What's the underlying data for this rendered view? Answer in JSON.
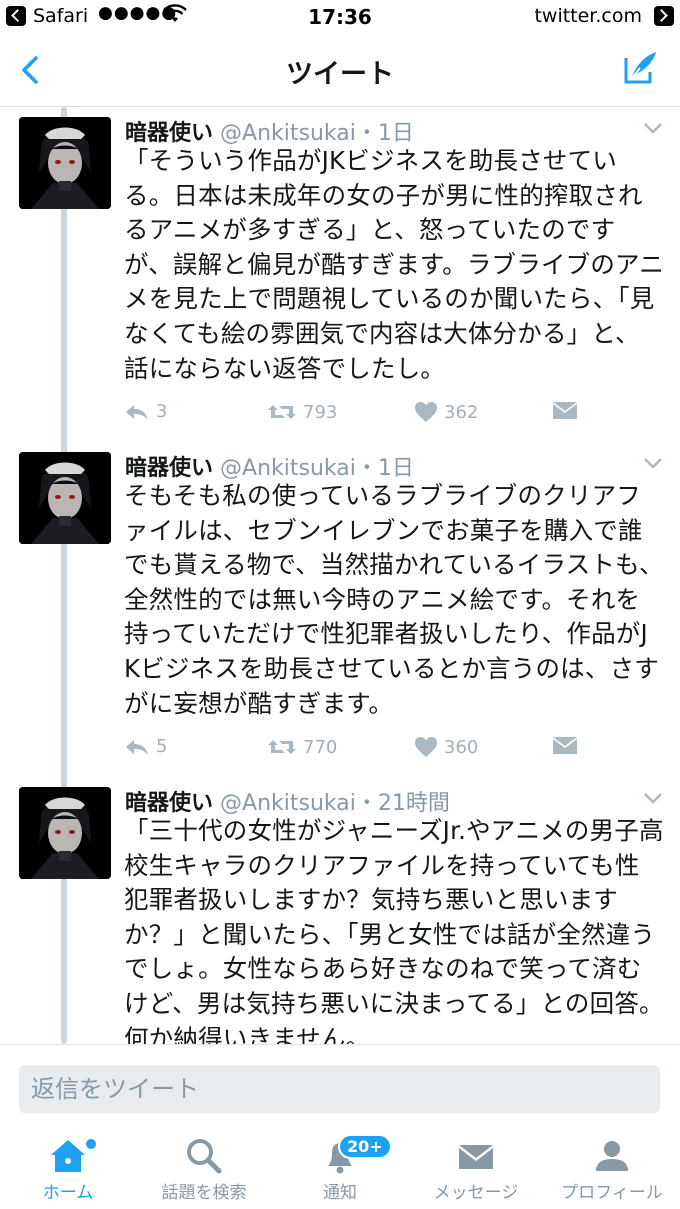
{
  "status_bar": {
    "carrier": "Safari",
    "signal": "●●●●●",
    "time": "17:36",
    "url": "twitter.com"
  },
  "nav": {
    "title": "ツイート",
    "back_icon": "chevron-left-icon",
    "compose_icon": "compose-tweet-icon"
  },
  "tweets": [
    {
      "name": "暗器使い",
      "handle": "@Ankitsukai",
      "time": "1日",
      "text": "「そういう作品がJKビジネスを助長させている。日本は未成年の女の子が男に性的搾取されるアニメが多すぎる」と、怒っていたのですが、誤解と偏見が酷すぎます。ラブライブのアニメを見た上で問題視しているのか聞いたら、「見なくても絵の雰囲気で内容は大体分かる」と、話にならない返答でしたし。",
      "reply_count": "3",
      "retweet_count": "793",
      "like_count": "362"
    },
    {
      "name": "暗器使い",
      "handle": "@Ankitsukai",
      "time": "1日",
      "text": "そもそも私の使っているラブライブのクリアファイルは、セブンイレブンでお菓子を購入で誰でも貰える物で、当然描かれているイラストも、全然性的では無い今時のアニメ絵です。それを持っていただけで性犯罪者扱いしたり、作品がJKビジネスを助長させているとか言うのは、さすがに妄想が酷すぎます。",
      "reply_count": "5",
      "retweet_count": "770",
      "like_count": "360"
    },
    {
      "name": "暗器使い",
      "handle": "@Ankitsukai",
      "time": "21時間",
      "text": "「三十代の女性がジャニーズJr.やアニメの男子高校生キャラのクリアファイルを持っていても性犯罪者扱いしますか？気持ち悪いと思いますか？」と聞いたら、「男と女性では話が全然違うでしょ。女性ならあら好きなのねで笑って済むけど、男は気持ち悪いに決まってる」との回答。何か納得いきません。",
      "reply_count": "",
      "retweet_count": "",
      "like_count": ""
    }
  ],
  "reply_bar": {
    "placeholder": "返信をツイート"
  },
  "tabs": [
    {
      "label": "ホーム",
      "icon": "home-icon"
    },
    {
      "label": "話題を検索",
      "icon": "search-icon"
    },
    {
      "label": "通知",
      "icon": "bell-icon"
    },
    {
      "label": "メッセージ",
      "icon": "envelope-icon"
    },
    {
      "label": "プロフィール",
      "icon": "person-icon"
    }
  ],
  "notification_badge": "20+",
  "colors": {
    "accent": "#1da1f2",
    "muted": "#8899a6",
    "text": "#14171a"
  }
}
